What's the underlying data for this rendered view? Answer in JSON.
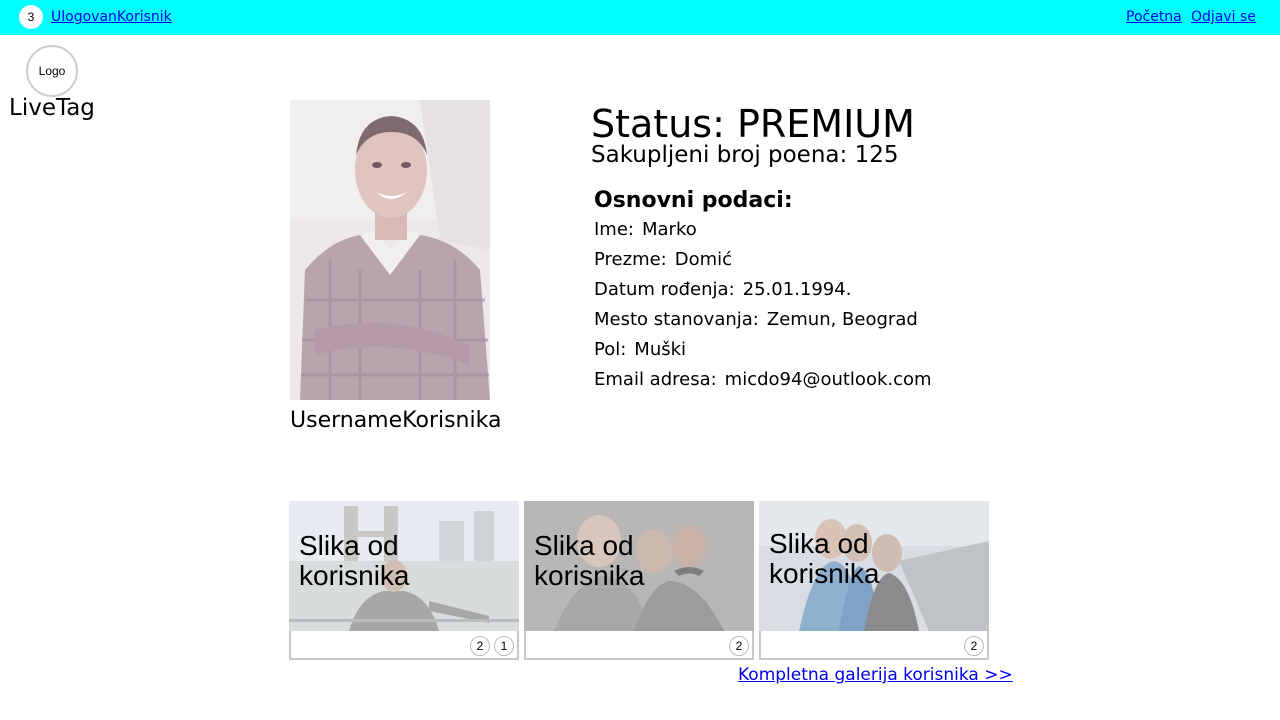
{
  "header": {
    "notification_count": "3",
    "username_link": "UlogovanKorisnik",
    "nav": {
      "home": "Početna",
      "logout": "Odjavi se"
    },
    "bar_color": "#00ffff"
  },
  "brand": {
    "logo_text": "Logo",
    "name": "LiveTag"
  },
  "profile": {
    "username": "UsernameKorisnika",
    "status": "Status: PREMIUM",
    "points": "Sakupljeni broj poena: 125",
    "basic_title": "Osnovni podaci:",
    "fields": [
      {
        "label": "Ime:",
        "value": "Marko"
      },
      {
        "label": "Prezme:",
        "value": "Domić"
      },
      {
        "label": "Datum rođenja:",
        "value": "25.01.1994."
      },
      {
        "label": "Mesto stanovanja:",
        "value": "Zemun, Beograd"
      },
      {
        "label": "Pol:",
        "value": "Muški"
      },
      {
        "label": "Email adresa:",
        "value": "micdo94@outlook.com"
      }
    ]
  },
  "gallery": {
    "cards": [
      {
        "caption": "Slika od korisnika",
        "badges": [
          "2",
          "1"
        ]
      },
      {
        "caption": "Slika od korisnika",
        "badges": [
          "2"
        ]
      },
      {
        "caption": "Slika od korisnika",
        "badges": [
          "2"
        ]
      }
    ],
    "full_gallery_link": "Kompletna galerija korisnika >>"
  }
}
